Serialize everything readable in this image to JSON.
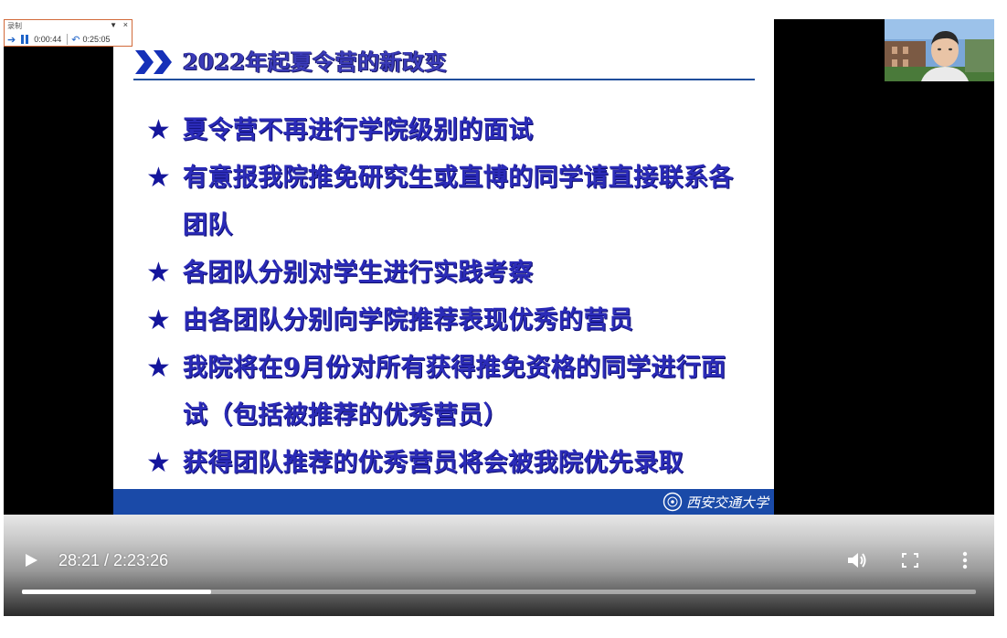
{
  "slide": {
    "title": "2022年起夏令营的新改变",
    "bullets": [
      "夏令营不再进行学院级别的面试",
      "有意报我院推免研究生或直博的同学请直接联系各团队",
      "各团队分别对学生进行实践考察",
      "由各团队分别向学院推荐表现优秀的营员",
      "我院将在9月份对所有获得推免资格的同学进行面试（包括被推荐的优秀营员）",
      "获得团队推荐的优秀营员将会被我院优先录取"
    ],
    "bullet_icon": "star-icon",
    "university_logo": "西安交通大学",
    "colors": {
      "text": "#2b2bb8",
      "footer": "#1a4aa8",
      "rule": "#1f4e9b"
    }
  },
  "player": {
    "current_time": "28:21",
    "duration": "2:23:26",
    "time_display": "28:21 / 2:23:26",
    "progress": 0.198
  },
  "recording_widget": {
    "title": "录制",
    "elapsed": "0:00:44",
    "total": "0:25:05"
  }
}
